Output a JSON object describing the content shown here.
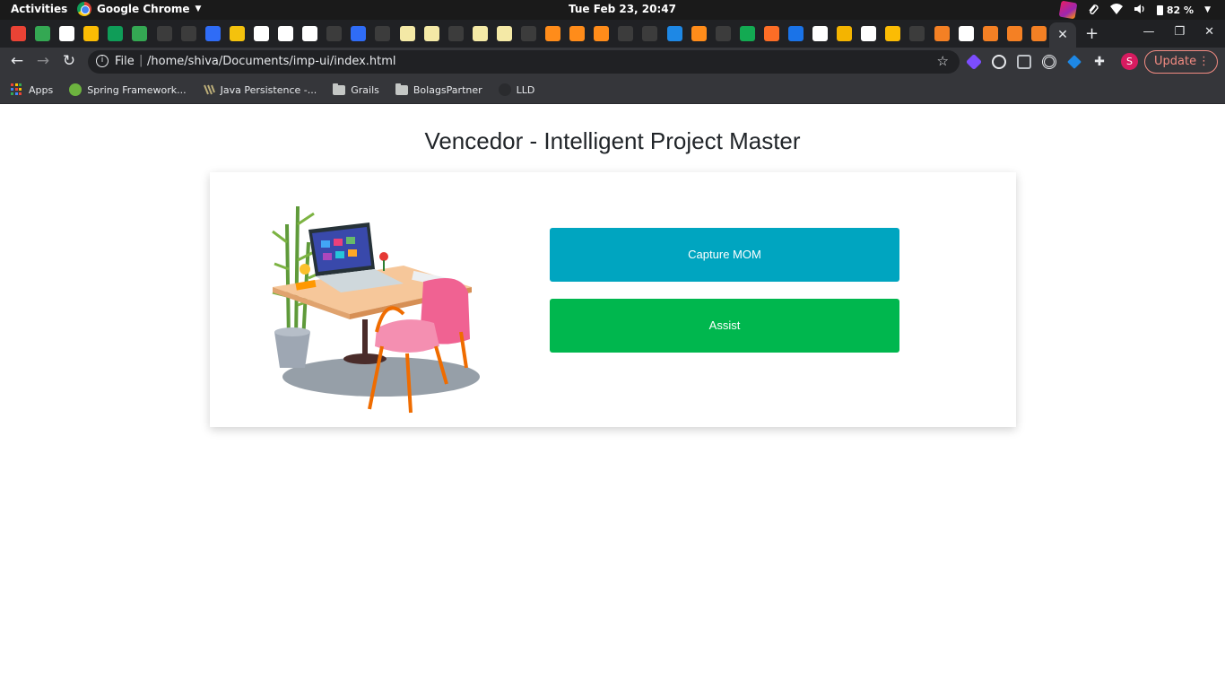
{
  "os_bar": {
    "activities": "Activities",
    "app_name": "Google Chrome",
    "clock": "Tue Feb 23, 20:47",
    "battery": "82 %"
  },
  "tabs": {
    "favicon_colors": [
      "#ea4335",
      "#34a853",
      "#ffffff",
      "#fbbc04",
      "#0f9d58",
      "#34a853",
      "#3c3c3c",
      "#3c3c3c",
      "#2f6cf6",
      "#f4c20d",
      "#ffffff",
      "#ffffff",
      "#ffffff",
      "#3c3c3c",
      "#2f6cf6",
      "#3c3c3c",
      "#f4e9a6",
      "#f4e9a6",
      "#3c3c3c",
      "#f4e9a6",
      "#f4e9a6",
      "#3c3c3c",
      "#ff8c1a",
      "#ff8c1a",
      "#ff8c1a",
      "#3c3c3c",
      "#3c3c3c",
      "#1e88e5",
      "#ff8c1a",
      "#3c3c3c",
      "#13aa52",
      "#fc6d26",
      "#1a73e8",
      "#ffffff",
      "#f4b400",
      "#ffffff",
      "#fbbc04",
      "#3c3c3c",
      "#f48024",
      "#ffffff",
      "#f48024",
      "#f48024",
      "#f48024"
    ],
    "active_tab_icon": "close-icon",
    "new_tab_icon": "plus-icon"
  },
  "toolbar": {
    "scheme": "File",
    "url": "/home/shiva/Documents/imp-ui/index.html",
    "profile_initial": "S",
    "update_label": "Update"
  },
  "bookmarks": [
    {
      "label": "Apps",
      "icon": "apps-grid-icon"
    },
    {
      "label": "Spring Framework...",
      "icon": "spring-leaf-icon"
    },
    {
      "label": "Java Persistence -...",
      "icon": "hibernate-icon"
    },
    {
      "label": "Grails",
      "icon": "folder-icon"
    },
    {
      "label": "BolagsPartner",
      "icon": "folder-icon"
    },
    {
      "label": "LLD",
      "icon": "github-icon"
    }
  ],
  "page": {
    "title": "Vencedor - Intelligent Project Master",
    "capture_label": "Capture MOM",
    "assist_label": "Assist",
    "capture_color": "#00a5c0",
    "assist_color": "#00b74e"
  }
}
